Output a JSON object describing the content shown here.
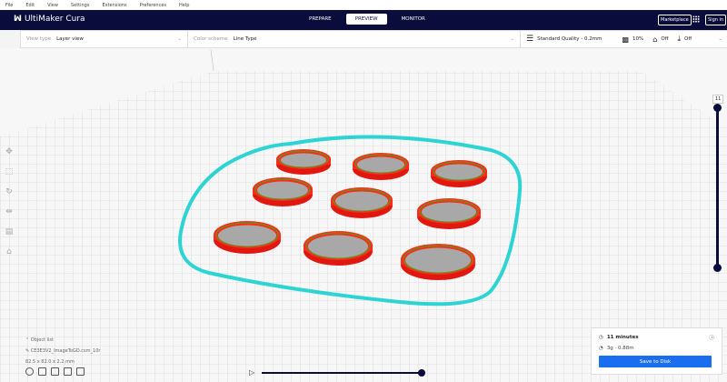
{
  "menu": [
    "File",
    "Edit",
    "View",
    "Settings",
    "Extensions",
    "Preferences",
    "Help"
  ],
  "app_title": "UltiMaker Cura",
  "stages": [
    "PREPARE",
    "PREVIEW",
    "MONITOR"
  ],
  "active_stage": "PREVIEW",
  "marketplace": "Marketplace",
  "signin": "Sign in",
  "toolbar": {
    "view_type_label": "View type",
    "view_type": "Layer view",
    "color_scheme_label": "Color scheme",
    "color_scheme": "Line Type",
    "quality": "Standard Quality - 0.2mm",
    "infill": "10%",
    "support": "Off",
    "adhesion": "Off"
  },
  "layer": "11",
  "object": {
    "list": "Object list",
    "name": "CE3E3V2_ImageToGD.csm_10r",
    "dims": "82.5 x 82.0 x 2.2 mm"
  },
  "print": {
    "time": "11 minutes",
    "material": "3g · 0.88m",
    "save": "Save to Disk"
  },
  "colors": {
    "header": "#0a0d3b",
    "accent": "#196ef0",
    "wall": "#ff2a1a",
    "skirt": "#2ed4d4"
  }
}
